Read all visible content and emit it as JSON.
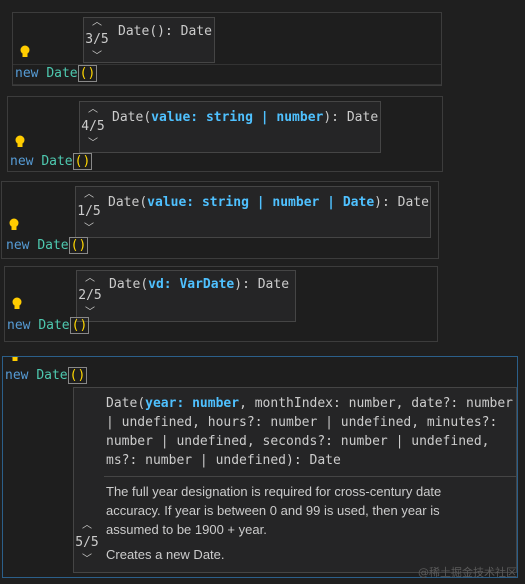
{
  "code": {
    "keyword": "new",
    "class": "Date",
    "parens": "()"
  },
  "overloads": [
    {
      "counter": "3/5",
      "name": "Date",
      "params": "()",
      "ret": ": Date"
    },
    {
      "counter": "4/5",
      "name": "Date",
      "open": "(",
      "p1": "value",
      "sep1": ": ",
      "t1": "string",
      "bar1": " | ",
      "t2": "number",
      "close": "): Date"
    },
    {
      "counter": "1/5",
      "name": "Date",
      "open": "(",
      "p1": "value",
      "sep1": ": ",
      "t1": "string",
      "bar1": " | ",
      "t2": "number",
      "bar2": " | ",
      "t3": "Date",
      "close": "): Date"
    },
    {
      "counter": "2/5",
      "name": "Date",
      "open": "(",
      "p1": "vd",
      "sep1": ": ",
      "t1": "VarDate",
      "close": "): Date"
    }
  ],
  "expanded": {
    "counter": "5/5",
    "name": "Date",
    "open": "(",
    "p1": "year",
    "sep1": ": ",
    "t1": "number",
    "rest_line1": ", monthIndex: number, date?: number",
    "line2": "| undefined, hours?: number | undefined, minutes?:",
    "line3": "number | undefined, seconds?: number | undefined,",
    "line4": "ms?: number | undefined): Date",
    "doc1": "The full year designation is required for cross-century date accuracy. If year is between 0 and 99 is used, then year is assumed to be 1900 + year.",
    "doc2": "Creates a new Date."
  },
  "icons": {
    "lightbulb": "lightbulb-icon",
    "chevron_up": "chevron-up-icon",
    "chevron_down": "chevron-down-icon"
  },
  "colors": {
    "keyword": "#569cd6",
    "class": "#4ec9b0",
    "param": "#9cdcfe",
    "bulb": "#ffcc00"
  },
  "watermark": "@稀土掘金技术社区"
}
